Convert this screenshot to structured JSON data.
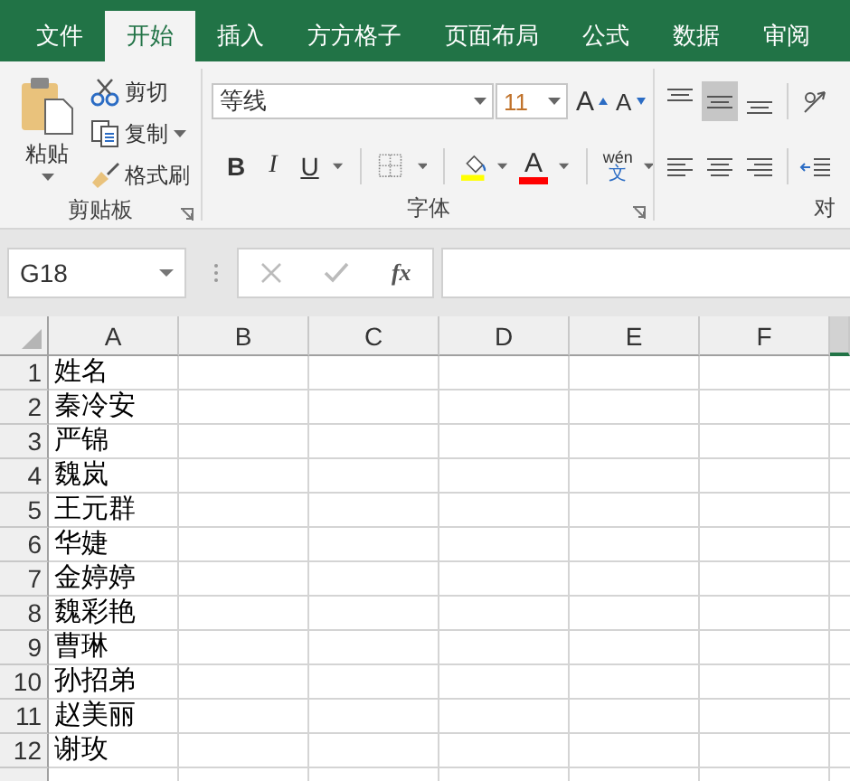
{
  "tabs": [
    {
      "label": "文件",
      "selected": false
    },
    {
      "label": "开始",
      "selected": true
    },
    {
      "label": "插入",
      "selected": false
    },
    {
      "label": "方方格子",
      "selected": false
    },
    {
      "label": "页面布局",
      "selected": false
    },
    {
      "label": "公式",
      "selected": false
    },
    {
      "label": "数据",
      "selected": false
    },
    {
      "label": "审阅",
      "selected": false
    }
  ],
  "clipboard": {
    "paste": "粘贴",
    "cut": "剪切",
    "copy": "复制",
    "format_painter": "格式刷",
    "label": "剪贴板"
  },
  "font": {
    "font_name": "等线",
    "font_size": "11",
    "grow": "A",
    "shrink": "A",
    "bold": "B",
    "italic": "I",
    "underline": "U",
    "font_color": "A",
    "phonetic": "wén",
    "phonetic_char": "文",
    "label": "字体"
  },
  "alignment": {
    "label": "对",
    "buttons": [
      {
        "kind": "top",
        "selected": false
      },
      {
        "kind": "middle",
        "selected": true
      },
      {
        "kind": "bottom",
        "selected": false
      },
      {
        "kind": "orientation",
        "selected": false
      },
      {
        "kind": "left",
        "selected": false
      },
      {
        "kind": "center",
        "selected": false
      },
      {
        "kind": "right",
        "selected": false
      },
      {
        "kind": "indent",
        "selected": false
      }
    ]
  },
  "formula_bar": {
    "name_box": "G18",
    "function_label": "fx"
  },
  "sheet": {
    "columns": [
      {
        "label": "A",
        "selected": false
      },
      {
        "label": "B",
        "selected": false
      },
      {
        "label": "C",
        "selected": false
      },
      {
        "label": "D",
        "selected": false
      },
      {
        "label": "E",
        "selected": false
      },
      {
        "label": "F",
        "selected": false
      },
      {
        "selected": true
      }
    ],
    "rows": [
      {
        "number": "1",
        "cells": [
          "姓名"
        ]
      },
      {
        "number": "2",
        "cells": [
          "秦冷安"
        ]
      },
      {
        "number": "3",
        "cells": [
          "严锦"
        ]
      },
      {
        "number": "4",
        "cells": [
          "魏岚"
        ]
      },
      {
        "number": "5",
        "cells": [
          "王元群"
        ]
      },
      {
        "number": "6",
        "cells": [
          "华婕"
        ]
      },
      {
        "number": "7",
        "cells": [
          "金婷婷"
        ]
      },
      {
        "number": "8",
        "cells": [
          "魏彩艳"
        ]
      },
      {
        "number": "9",
        "cells": [
          "曹琳"
        ]
      },
      {
        "number": "10",
        "cells": [
          "孙招弟"
        ]
      },
      {
        "number": "11",
        "cells": [
          "赵美丽"
        ]
      },
      {
        "number": "12",
        "cells": [
          "谢玫"
        ]
      },
      {
        "cells": []
      }
    ]
  }
}
